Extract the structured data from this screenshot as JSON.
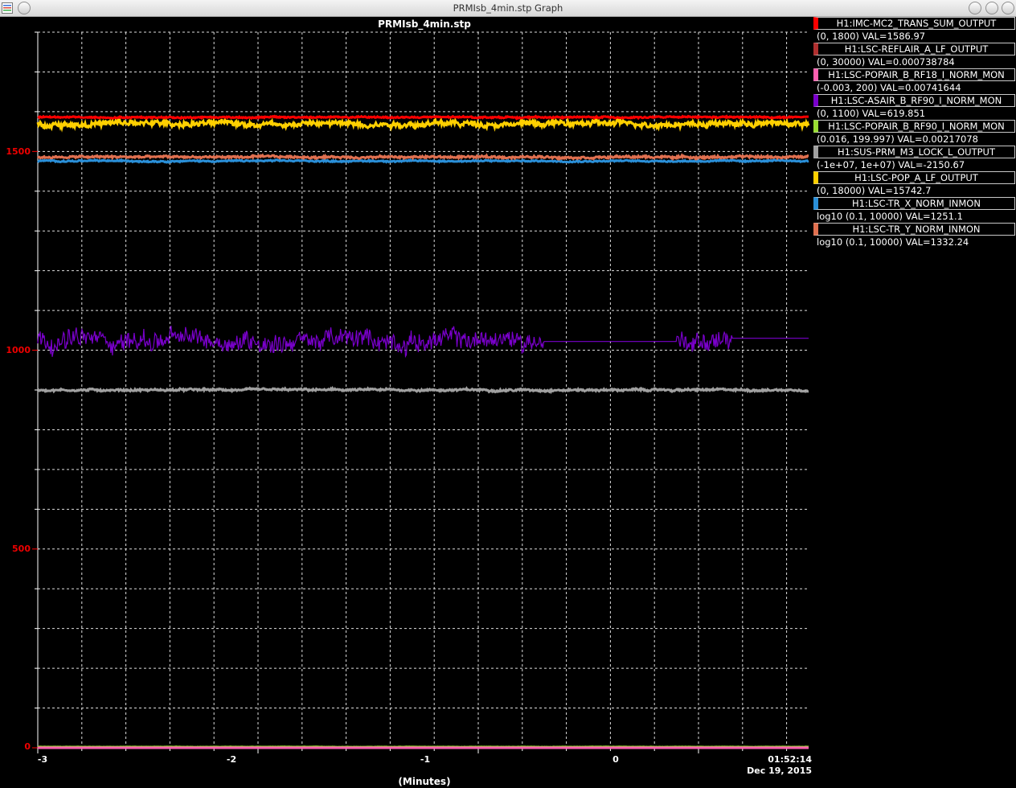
{
  "window": {
    "title": "PRMIsb_4min.stp Graph"
  },
  "chart_data": {
    "type": "line",
    "title": "PRMIsb_4min.stp",
    "xlabel": "(Minutes)",
    "xlim": [
      -3,
      0.5
    ],
    "ylim": [
      0,
      1800
    ],
    "x_ticks": [
      -3,
      -2,
      -1,
      0
    ],
    "x_tick_labels": [
      "-3",
      "-2",
      "-1",
      "0"
    ],
    "y_ticks": [
      0,
      500,
      1000,
      1500
    ],
    "y_tick_labels": [
      "0",
      "500",
      "1000",
      "1500"
    ],
    "x_end_time": "01:52:14",
    "x_end_date": "Dec 19, 2015",
    "grid": true,
    "legend_position": "right",
    "series": [
      {
        "name": "H1:IMC-MC2_TRANS_SUM_OUTPUT",
        "range": "(0, 1800) VAL=1586.97",
        "color": "#ff0000",
        "level": 1586,
        "noise": 2
      },
      {
        "name": "H1:LSC-REFLAIR_A_LF_OUTPUT",
        "range": "(0, 30000) VAL=0.000738784",
        "color": "#b03030",
        "level": 0,
        "noise": 0
      },
      {
        "name": "H1:LSC-POPAIR_B_RF18_I_NORM_MON",
        "range": "(-0.003, 200) VAL=0.00741644",
        "color": "#ff5fb0",
        "level": 0,
        "noise": 0
      },
      {
        "name": "H1:LSC-ASAIR_B_RF90_I_NORM_MON",
        "range": "(0, 1100) VAL=619.851",
        "color": "#7a00cc",
        "level": 1025,
        "noise": 28,
        "flat_segments": [
          [
            -0.7,
            -0.1,
            1022
          ],
          [
            0.15,
            0.5,
            1030
          ]
        ]
      },
      {
        "name": "H1:LSC-POPAIR_B_RF90_I_NORM_MON",
        "range": "(0.016, 199.997) VAL=0.00217078",
        "color": "#99dd33",
        "level": 2,
        "noise": 0.3
      },
      {
        "name": "H1:SUS-PRM_M3_LOCK_L_OUTPUT",
        "range": "(-1e+07, 1e+07) VAL=-2150.67",
        "color": "#a0a0a0",
        "level": 900,
        "noise": 3
      },
      {
        "name": "H1:LSC-POP_A_LF_OUTPUT",
        "range": "(0, 18000) VAL=15742.7",
        "color": "#ffd000",
        "level": 1570,
        "noise": 8
      },
      {
        "name": "H1:LSC-TR_X_NORM_INMON",
        "range": "log10 (0.1, 10000) VAL=1251.1",
        "color": "#2a8fd8",
        "level": 1476,
        "noise": 2
      },
      {
        "name": "H1:LSC-TR_Y_NORM_INMON",
        "range": "log10 (0.1, 10000) VAL=1332.24",
        "color": "#e07050",
        "level": 1486,
        "noise": 3
      }
    ]
  }
}
